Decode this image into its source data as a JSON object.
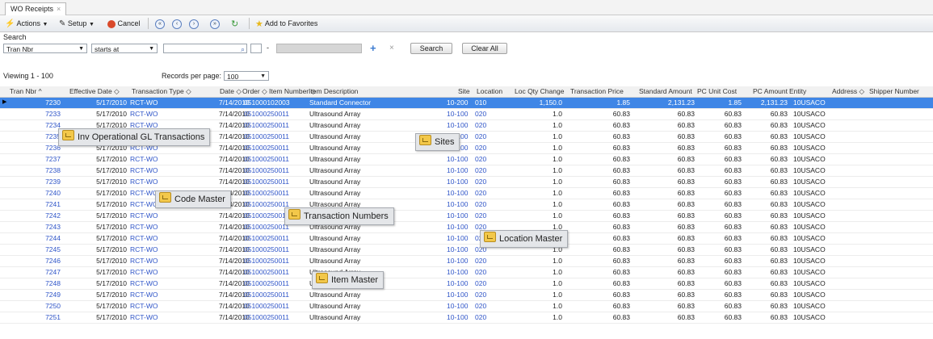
{
  "tab": {
    "label": "WO Receipts",
    "close": "×"
  },
  "toolbar": {
    "actions": "Actions",
    "setup": "Setup",
    "cancel": "Cancel",
    "add_favorites": "Add to Favorites"
  },
  "search": {
    "label": "Search",
    "field": "Tran Nbr",
    "operator": "starts at",
    "value": "",
    "search_btn": "Search",
    "clear_btn": "Clear All"
  },
  "paging": {
    "viewing": "Viewing 1 - 100",
    "rpp_label": "Records per page:",
    "rpp_value": "100"
  },
  "columns": [
    "Tran Nbr ^",
    "Effective Date ◇",
    "Transaction Type ◇",
    "Date ◇",
    "Order ◇",
    "Item Number ◇",
    "Item Description",
    "Site",
    "Location",
    "Loc Qty Change",
    "Transaction Price",
    "Standard Amount",
    "PC Unit Cost",
    "PC Amount",
    "Entity",
    "Address ◇",
    "Shipper Number"
  ],
  "rows": [
    {
      "tran": "7230",
      "eff": "5/17/2010",
      "type": "RCT-WO",
      "date": "7/14/2010",
      "order": "0510001",
      "item": "02003",
      "desc": "Standard Connector",
      "site": "10-200",
      "loc": "010",
      "qty": "1,150.0",
      "price": "1.85",
      "std": "2,131.23",
      "unit": "1.85",
      "pcamt": "2,131.23",
      "entity": "10USACO"
    },
    {
      "tran": "7233",
      "eff": "5/17/2010",
      "type": "RCT-WO",
      "date": "7/14/2010",
      "order": "0510002",
      "item": "50011",
      "desc": "Ultrasound Array",
      "site": "10-100",
      "loc": "020",
      "qty": "1.0",
      "price": "60.83",
      "std": "60.83",
      "unit": "60.83",
      "pcamt": "60.83",
      "entity": "10USACO"
    },
    {
      "tran": "7234",
      "eff": "5/17/2010",
      "type": "RCT-WO",
      "date": "7/14/2010",
      "order": "0510002",
      "item": "50011",
      "desc": "Ultrasound Array",
      "site": "10-100",
      "loc": "020",
      "qty": "1.0",
      "price": "60.83",
      "std": "60.83",
      "unit": "60.83",
      "pcamt": "60.83",
      "entity": "10USACO"
    },
    {
      "tran": "7235",
      "eff": "5/17/2010",
      "type": "RCT-WO",
      "date": "7/14/2010",
      "order": "0510002",
      "item": "50011",
      "desc": "Ultrasound Array",
      "site": "10-100",
      "loc": "020",
      "qty": "1.0",
      "price": "60.83",
      "std": "60.83",
      "unit": "60.83",
      "pcamt": "60.83",
      "entity": "10USACO"
    },
    {
      "tran": "7236",
      "eff": "5/17/2010",
      "type": "RCT-WO",
      "date": "7/14/2010",
      "order": "0510002",
      "item": "50011",
      "desc": "Ultrasound Array",
      "site": "10-100",
      "loc": "020",
      "qty": "1.0",
      "price": "60.83",
      "std": "60.83",
      "unit": "60.83",
      "pcamt": "60.83",
      "entity": "10USACO"
    },
    {
      "tran": "7237",
      "eff": "5/17/2010",
      "type": "RCT-WO",
      "date": "7/14/2010",
      "order": "0510002",
      "item": "50011",
      "desc": "Ultrasound Array",
      "site": "10-100",
      "loc": "020",
      "qty": "1.0",
      "price": "60.83",
      "std": "60.83",
      "unit": "60.83",
      "pcamt": "60.83",
      "entity": "10USACO"
    },
    {
      "tran": "7238",
      "eff": "5/17/2010",
      "type": "RCT-WO",
      "date": "7/14/2010",
      "order": "0510002",
      "item": "50011",
      "desc": "Ultrasound Array",
      "site": "10-100",
      "loc": "020",
      "qty": "1.0",
      "price": "60.83",
      "std": "60.83",
      "unit": "60.83",
      "pcamt": "60.83",
      "entity": "10USACO"
    },
    {
      "tran": "7239",
      "eff": "5/17/2010",
      "type": "RCT-WO",
      "date": "7/14/2010",
      "order": "0510002",
      "item": "50011",
      "desc": "Ultrasound Array",
      "site": "10-100",
      "loc": "020",
      "qty": "1.0",
      "price": "60.83",
      "std": "60.83",
      "unit": "60.83",
      "pcamt": "60.83",
      "entity": "10USACO"
    },
    {
      "tran": "7240",
      "eff": "5/17/2010",
      "type": "RCT-WO",
      "date": "7/14/2010",
      "order": "0510002",
      "item": "50011",
      "desc": "Ultrasound Array",
      "site": "10-100",
      "loc": "020",
      "qty": "1.0",
      "price": "60.83",
      "std": "60.83",
      "unit": "60.83",
      "pcamt": "60.83",
      "entity": "10USACO"
    },
    {
      "tran": "7241",
      "eff": "5/17/2010",
      "type": "RCT-WO",
      "date": "7/14/2010",
      "order": "0510002",
      "item": "50011",
      "desc": "Ultrasound Array",
      "site": "10-100",
      "loc": "020",
      "qty": "1.0",
      "price": "60.83",
      "std": "60.83",
      "unit": "60.83",
      "pcamt": "60.83",
      "entity": "10USACO"
    },
    {
      "tran": "7242",
      "eff": "5/17/2010",
      "type": "RCT-WO",
      "date": "7/14/2010",
      "order": "0510002",
      "item": "50011",
      "desc": "Ultrasound Array",
      "site": "10-100",
      "loc": "020",
      "qty": "1.0",
      "price": "60.83",
      "std": "60.83",
      "unit": "60.83",
      "pcamt": "60.83",
      "entity": "10USACO"
    },
    {
      "tran": "7243",
      "eff": "5/17/2010",
      "type": "RCT-WO",
      "date": "7/14/2010",
      "order": "0510002",
      "item": "50011",
      "desc": "Ultrasound Array",
      "site": "10-100",
      "loc": "020",
      "qty": "1.0",
      "price": "60.83",
      "std": "60.83",
      "unit": "60.83",
      "pcamt": "60.83",
      "entity": "10USACO"
    },
    {
      "tran": "7244",
      "eff": "5/17/2010",
      "type": "RCT-WO",
      "date": "7/14/2010",
      "order": "0510002",
      "item": "50011",
      "desc": "Ultrasound Array",
      "site": "10-100",
      "loc": "020",
      "qty": "1.0",
      "price": "60.83",
      "std": "60.83",
      "unit": "60.83",
      "pcamt": "60.83",
      "entity": "10USACO"
    },
    {
      "tran": "7245",
      "eff": "5/17/2010",
      "type": "RCT-WO",
      "date": "7/14/2010",
      "order": "0510002",
      "item": "50011",
      "desc": "Ultrasound Array",
      "site": "10-100",
      "loc": "020",
      "qty": "1.0",
      "price": "60.83",
      "std": "60.83",
      "unit": "60.83",
      "pcamt": "60.83",
      "entity": "10USACO"
    },
    {
      "tran": "7246",
      "eff": "5/17/2010",
      "type": "RCT-WO",
      "date": "7/14/2010",
      "order": "0510002",
      "item": "50011",
      "desc": "Ultrasound Array",
      "site": "10-100",
      "loc": "020",
      "qty": "1.0",
      "price": "60.83",
      "std": "60.83",
      "unit": "60.83",
      "pcamt": "60.83",
      "entity": "10USACO"
    },
    {
      "tran": "7247",
      "eff": "5/17/2010",
      "type": "RCT-WO",
      "date": "7/14/2010",
      "order": "0510002",
      "item": "50011",
      "desc": "Ultrasound Array",
      "site": "10-100",
      "loc": "020",
      "qty": "1.0",
      "price": "60.83",
      "std": "60.83",
      "unit": "60.83",
      "pcamt": "60.83",
      "entity": "10USACO"
    },
    {
      "tran": "7248",
      "eff": "5/17/2010",
      "type": "RCT-WO",
      "date": "7/14/2010",
      "order": "0510002",
      "item": "50011",
      "desc": "Ultrasound Array",
      "site": "10-100",
      "loc": "020",
      "qty": "1.0",
      "price": "60.83",
      "std": "60.83",
      "unit": "60.83",
      "pcamt": "60.83",
      "entity": "10USACO"
    },
    {
      "tran": "7249",
      "eff": "5/17/2010",
      "type": "RCT-WO",
      "date": "7/14/2010",
      "order": "0510002",
      "item": "50011",
      "desc": "Ultrasound Array",
      "site": "10-100",
      "loc": "020",
      "qty": "1.0",
      "price": "60.83",
      "std": "60.83",
      "unit": "60.83",
      "pcamt": "60.83",
      "entity": "10USACO"
    },
    {
      "tran": "7250",
      "eff": "5/17/2010",
      "type": "RCT-WO",
      "date": "7/14/2010",
      "order": "0510002",
      "item": "50011",
      "desc": "Ultrasound Array",
      "site": "10-100",
      "loc": "020",
      "qty": "1.0",
      "price": "60.83",
      "std": "60.83",
      "unit": "60.83",
      "pcamt": "60.83",
      "entity": "10USACO"
    },
    {
      "tran": "7251",
      "eff": "5/17/2010",
      "type": "RCT-WO",
      "date": "7/14/2010",
      "order": "0510002",
      "item": "50011",
      "desc": "Ultrasound Array",
      "site": "10-100",
      "loc": "020",
      "qty": "1.0",
      "price": "60.83",
      "std": "60.83",
      "unit": "60.83",
      "pcamt": "60.83",
      "entity": "10USACO"
    }
  ],
  "tooltips": {
    "inv_gl": "Inv Operational GL Transactions",
    "sites": "Sites",
    "code_master": "Code Master",
    "transaction_numbers": "Transaction Numbers",
    "location_master": "Location Master",
    "item_master": "Item Master"
  },
  "icons": {
    "actions": "bolt-icon",
    "setup": "wrench-icon",
    "cancel": "cancel-icon",
    "favorites": "star-icon"
  },
  "colors": {
    "selected_row": "#3f86e6",
    "link": "#2f55c8"
  }
}
